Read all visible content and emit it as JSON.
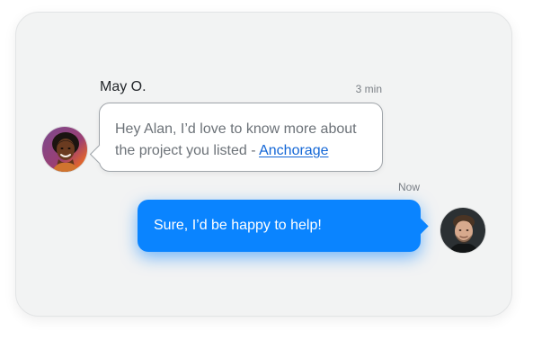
{
  "conversation": {
    "incoming": {
      "sender_name": "May O.",
      "time": "3 min",
      "text_before_link": "Hey Alan, I’d love to know more about the project you listed - ",
      "link_text": "Anchorage",
      "avatar_icon": "person-avatar-icon"
    },
    "outgoing": {
      "time": "Now",
      "text": "Sure, I’d be happy to help!",
      "avatar_icon": "person-avatar-icon"
    }
  },
  "colors": {
    "card_background": "#f2f3f3",
    "outgoing_bubble": "#0a84ff",
    "link": "#1266d6",
    "incoming_text": "#6c7278",
    "timestamp": "#7a7f85"
  }
}
